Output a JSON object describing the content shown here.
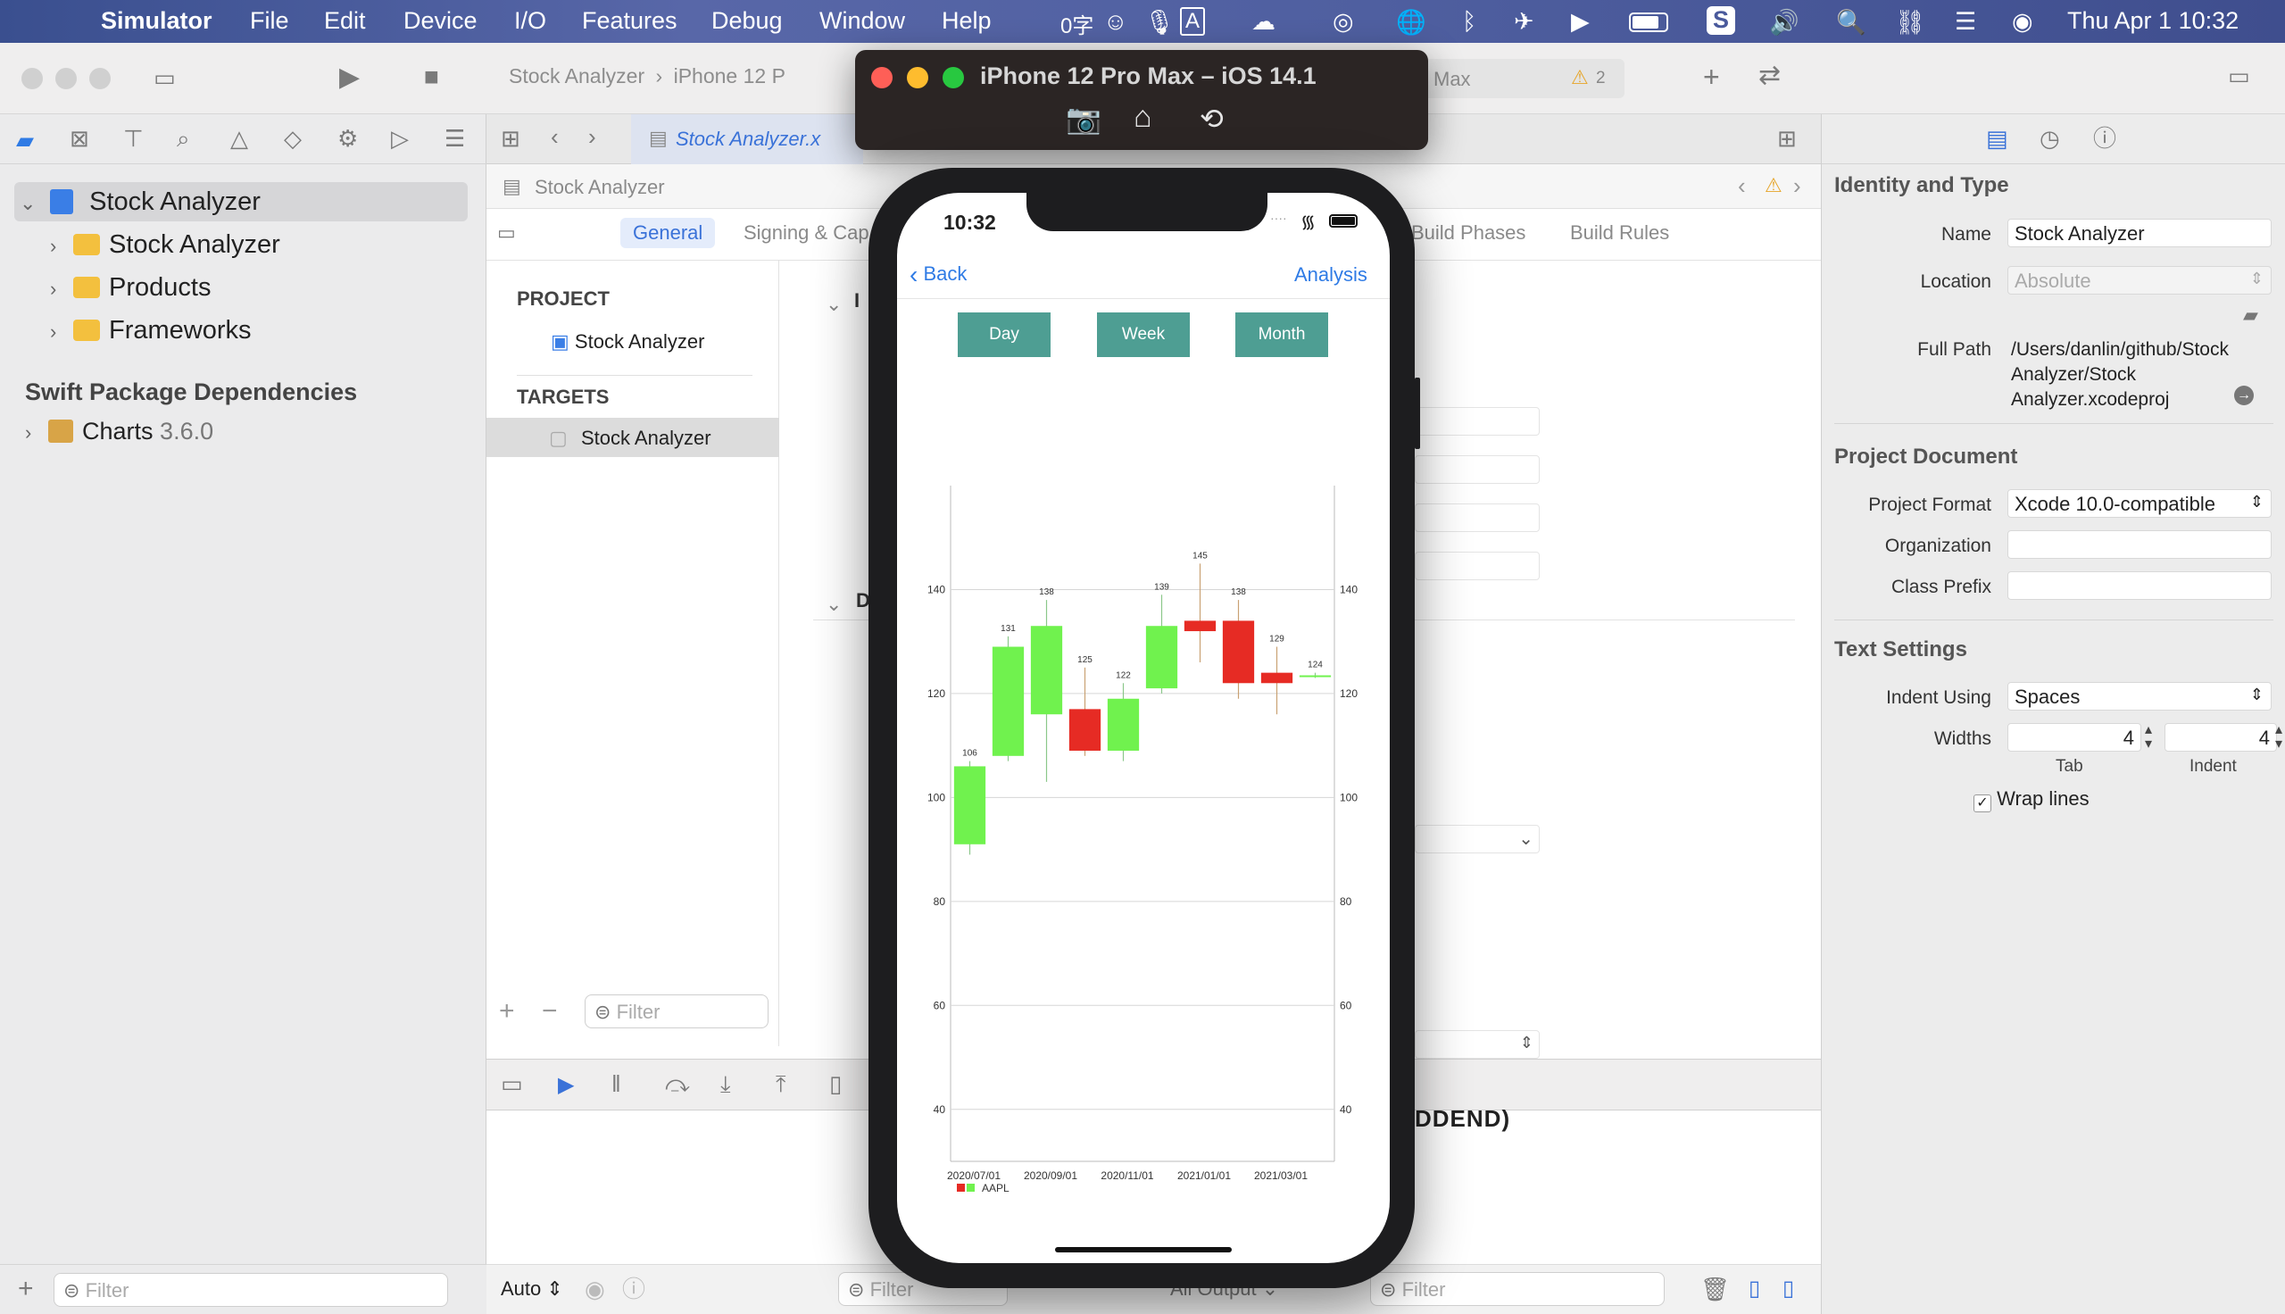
{
  "menubar": {
    "app": "Simulator",
    "items": [
      "File",
      "Edit",
      "Device",
      "I/O",
      "Features",
      "Debug",
      "Window",
      "Help"
    ],
    "input_method": "0字",
    "clock": "Thu Apr 1  10:32",
    "input_letter": "A"
  },
  "toolbar": {
    "breadcrumb_project": "Stock Analyzer",
    "breadcrumb_device": "iPhone 12 P",
    "scheme_tail": "Max",
    "warning_count": "2"
  },
  "navigator": {
    "root": "Stock Analyzer",
    "children": [
      "Stock Analyzer",
      "Products",
      "Frameworks"
    ],
    "spm_title": "Swift Package Dependencies",
    "package": "Charts",
    "package_version": "3.6.0",
    "filter_placeholder": "Filter"
  },
  "editor": {
    "tab_file": "Stock Analyzer.x",
    "jump_title": "Stock Analyzer",
    "settings_tabs": [
      "General",
      "Signing & Cap",
      "Build Phases",
      "Build Rules"
    ],
    "section_project": "PROJECT",
    "project_item": "Stock Analyzer",
    "section_targets": "TARGETS",
    "target_item": "Stock Analyzer",
    "list_filter_placeholder": "Filter",
    "section_i": "I",
    "section_d": "D",
    "debug_fragment": "DDEND)"
  },
  "bottombar": {
    "auto_label": "Auto",
    "filter_placeholder": "Filter",
    "output_label": "All Output",
    "filter2_placeholder": "Filter"
  },
  "inspector": {
    "section_identity": "Identity and Type",
    "name_label": "Name",
    "name_value": "Stock Analyzer",
    "location_label": "Location",
    "location_value": "Absolute",
    "fullpath_label": "Full Path",
    "fullpath_lines": [
      "/Users/danlin/github/Stock",
      "Analyzer/Stock",
      "Analyzer.xcodeproj"
    ],
    "section_project_doc": "Project Document",
    "format_label": "Project Format",
    "format_value": "Xcode 10.0-compatible",
    "org_label": "Organization",
    "prefix_label": "Class Prefix",
    "section_text": "Text Settings",
    "indent_label": "Indent Using",
    "indent_value": "Spaces",
    "widths_label": "Widths",
    "tab_width": "4",
    "indent_width": "4",
    "tab_caption": "Tab",
    "indent_caption": "Indent",
    "wrap_label": "Wrap lines"
  },
  "simulator": {
    "title": "iPhone 12 Pro Max – iOS 14.1"
  },
  "phone": {
    "time": "10:32",
    "back_label": "Back",
    "analysis_label": "Analysis",
    "segments": [
      "Day",
      "Week",
      "Month"
    ]
  },
  "chart_data": {
    "type": "candlestick",
    "ylim": [
      30,
      160
    ],
    "y_ticks": [
      40,
      60,
      80,
      100,
      120,
      140
    ],
    "x_tick_labels": [
      "2020/07/01",
      "2020/09/01",
      "2020/11/01",
      "2021/01/01",
      "2021/03/01"
    ],
    "legend": "AAPL",
    "colors": {
      "up": "#70f24e",
      "down": "#e62b24"
    },
    "candles": [
      {
        "open": 91,
        "close": 106,
        "high": 107,
        "low": 89,
        "label": "106"
      },
      {
        "open": 108,
        "close": 129,
        "high": 131,
        "low": 107,
        "label": "131"
      },
      {
        "open": 116,
        "close": 133,
        "high": 138,
        "low": 103,
        "label": "138"
      },
      {
        "open": 117,
        "close": 109,
        "high": 125,
        "low": 108,
        "label": "125"
      },
      {
        "open": 109,
        "close": 119,
        "high": 122,
        "low": 107,
        "label": "122"
      },
      {
        "open": 121,
        "close": 133,
        "high": 139,
        "low": 120,
        "label": "139"
      },
      {
        "open": 134,
        "close": 132,
        "high": 145,
        "low": 126,
        "label": "145"
      },
      {
        "open": 134,
        "close": 122,
        "high": 138,
        "low": 119,
        "label": "138"
      },
      {
        "open": 124,
        "close": 122,
        "high": 129,
        "low": 116,
        "label": "129"
      },
      {
        "open": 123.5,
        "close": 123.5,
        "high": 124,
        "low": 123,
        "label": "124"
      }
    ]
  }
}
